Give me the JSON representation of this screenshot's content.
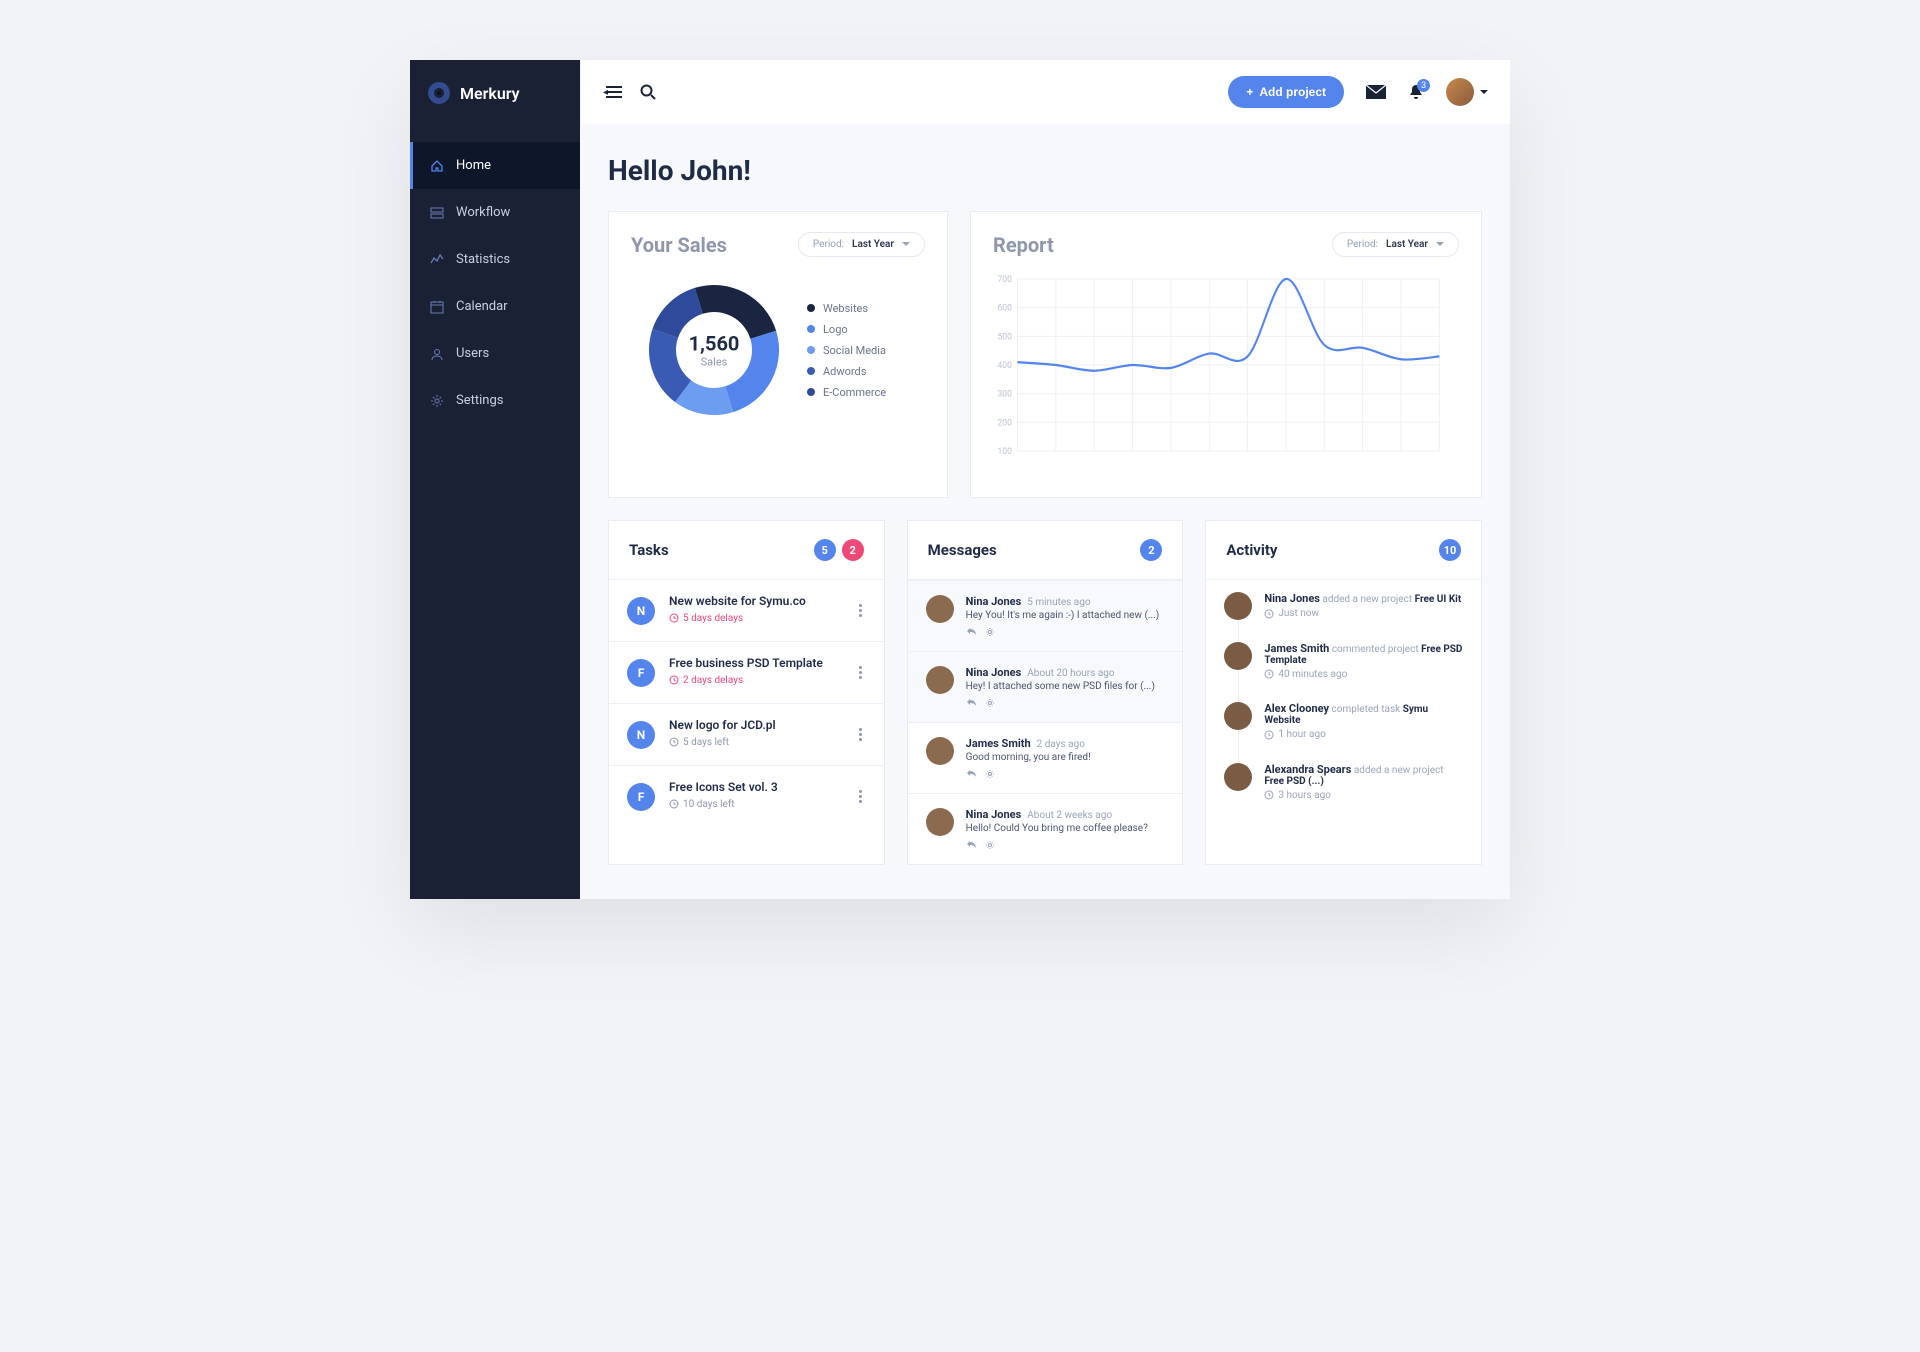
{
  "brand": {
    "name": "Merkury"
  },
  "sidebar": {
    "items": [
      {
        "label": "Home",
        "icon": "home-icon",
        "active": true
      },
      {
        "label": "Workflow",
        "icon": "workflow-icon",
        "active": false
      },
      {
        "label": "Statistics",
        "icon": "stats-icon",
        "active": false
      },
      {
        "label": "Calendar",
        "icon": "calendar-icon",
        "active": false
      },
      {
        "label": "Users",
        "icon": "users-icon",
        "active": false
      },
      {
        "label": "Settings",
        "icon": "settings-icon",
        "active": false
      }
    ]
  },
  "topbar": {
    "add_project_label": "Add project",
    "notification_count": "3"
  },
  "page": {
    "greeting": "Hello John!"
  },
  "sales": {
    "title": "Your Sales",
    "period_prefix": "Period:",
    "period_value": "Last Year",
    "total": "1,560",
    "total_label": "Sales",
    "legend": [
      {
        "label": "Websites",
        "color": "#1a2542"
      },
      {
        "label": "Logo",
        "color": "#5485ec"
      },
      {
        "label": "Social Media",
        "color": "#6d9df1"
      },
      {
        "label": "Adwords",
        "color": "#3a5bb4"
      },
      {
        "label": "E-Commerce",
        "color": "#2f4a9a"
      }
    ]
  },
  "report": {
    "title": "Report",
    "period_prefix": "Period:",
    "period_value": "Last Year"
  },
  "tasks": {
    "title": "Tasks",
    "badge_blue": "5",
    "badge_pink": "2",
    "items": [
      {
        "initial": "N",
        "title": "New website for Symu.co",
        "sub": "5 days delays",
        "delay": true
      },
      {
        "initial": "F",
        "title": "Free business PSD Template",
        "sub": "2 days delays",
        "delay": true
      },
      {
        "initial": "N",
        "title": "New logo for JCD.pl",
        "sub": "5 days left",
        "delay": false
      },
      {
        "initial": "F",
        "title": "Free Icons Set vol. 3",
        "sub": "10 days left",
        "delay": false
      }
    ]
  },
  "messages": {
    "title": "Messages",
    "badge": "2",
    "items": [
      {
        "name": "Nina Jones",
        "time": "5 minutes ago",
        "text": "Hey You! It's me again :-) I attached new (...)",
        "highlight": true
      },
      {
        "name": "Nina Jones",
        "time": "About 20 hours ago",
        "text": "Hey! I attached some new PSD files for (...)",
        "highlight": true
      },
      {
        "name": "James Smith",
        "time": "2 days ago",
        "text": "Good morning, you are fired!",
        "highlight": false
      },
      {
        "name": "Nina Jones",
        "time": "About 2 weeks ago",
        "text": "Hello! Could You bring me coffee please?",
        "highlight": false
      }
    ]
  },
  "activity": {
    "title": "Activity",
    "badge": "10",
    "items": [
      {
        "name": "Nina Jones",
        "verb": "added a new project",
        "object": "Free UI Kit",
        "time": "Just now"
      },
      {
        "name": "James Smith",
        "verb": "commented project",
        "object": "Free PSD Template",
        "time": "40 minutes ago"
      },
      {
        "name": "Alex Clooney",
        "verb": "completed task",
        "object": "Symu Website",
        "time": "1 hour ago"
      },
      {
        "name": "Alexandra Spears",
        "verb": "added a new project",
        "object": "Free PSD (...)",
        "time": "3 hours ago"
      }
    ]
  },
  "colors": {
    "accent": "#5485ec",
    "danger": "#ef4879",
    "sidebar": "#1a2135",
    "text_muted": "#8f97ac"
  },
  "chart_data": [
    {
      "type": "pie",
      "title": "Your Sales",
      "series": [
        {
          "name": "Websites",
          "value": 25,
          "color": "#1a2542"
        },
        {
          "name": "Logo",
          "value": 25,
          "color": "#5485ec"
        },
        {
          "name": "Social Media",
          "value": 15,
          "color": "#6d9df1"
        },
        {
          "name": "Adwords",
          "value": 20,
          "color": "#3a5bb4"
        },
        {
          "name": "E-Commerce",
          "value": 15,
          "color": "#2f4a9a"
        }
      ],
      "center_total": 1560,
      "center_label": "Sales"
    },
    {
      "type": "line",
      "title": "Report",
      "ylabel": "",
      "xlabel": "",
      "ylim": [
        100,
        700
      ],
      "yticks": [
        100,
        200,
        300,
        400,
        500,
        600,
        700
      ],
      "x": [
        0,
        1,
        2,
        3,
        4,
        5,
        6,
        7,
        8,
        9,
        10,
        11
      ],
      "series": [
        {
          "name": "Report",
          "values": [
            410,
            400,
            380,
            400,
            390,
            440,
            430,
            700,
            470,
            460,
            420,
            430
          ],
          "color": "#5485ec"
        }
      ]
    }
  ]
}
